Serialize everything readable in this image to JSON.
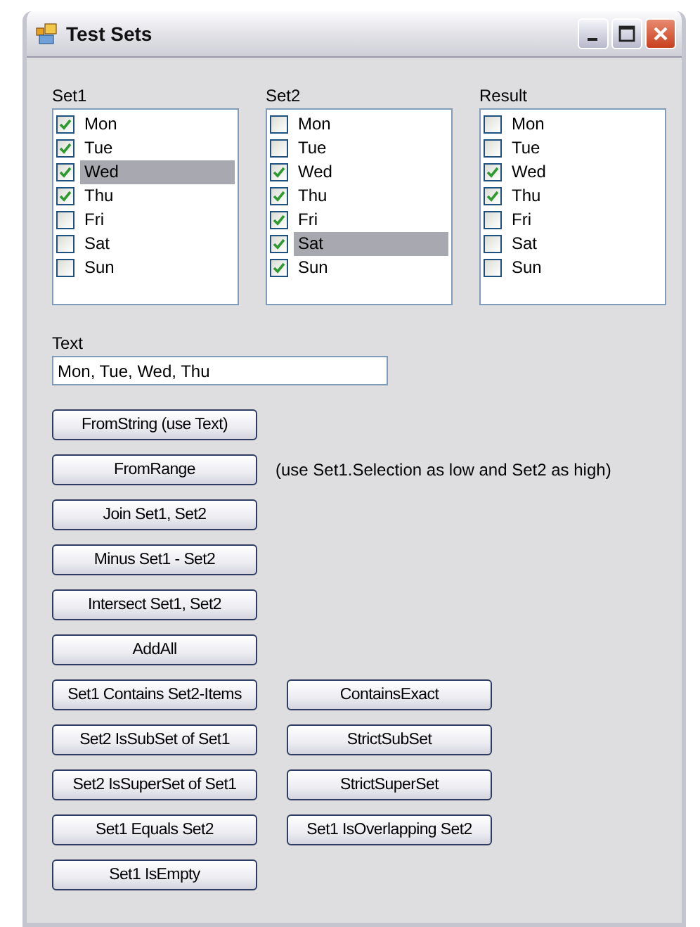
{
  "window": {
    "title": "Test Sets"
  },
  "lists": [
    {
      "label": "Set1",
      "items": [
        {
          "label": "Mon",
          "checked": true,
          "selected": false
        },
        {
          "label": "Tue",
          "checked": true,
          "selected": false
        },
        {
          "label": "Wed",
          "checked": true,
          "selected": true
        },
        {
          "label": "Thu",
          "checked": true,
          "selected": false
        },
        {
          "label": "Fri",
          "checked": false,
          "selected": false
        },
        {
          "label": "Sat",
          "checked": false,
          "selected": false
        },
        {
          "label": "Sun",
          "checked": false,
          "selected": false
        }
      ]
    },
    {
      "label": "Set2",
      "items": [
        {
          "label": "Mon",
          "checked": false,
          "selected": false
        },
        {
          "label": "Tue",
          "checked": false,
          "selected": false
        },
        {
          "label": "Wed",
          "checked": true,
          "selected": false
        },
        {
          "label": "Thu",
          "checked": true,
          "selected": false
        },
        {
          "label": "Fri",
          "checked": true,
          "selected": false
        },
        {
          "label": "Sat",
          "checked": true,
          "selected": true
        },
        {
          "label": "Sun",
          "checked": true,
          "selected": false
        }
      ]
    },
    {
      "label": "Result",
      "items": [
        {
          "label": "Mon",
          "checked": false,
          "selected": false
        },
        {
          "label": "Tue",
          "checked": false,
          "selected": false
        },
        {
          "label": "Wed",
          "checked": true,
          "selected": false
        },
        {
          "label": "Thu",
          "checked": true,
          "selected": false
        },
        {
          "label": "Fri",
          "checked": false,
          "selected": false
        },
        {
          "label": "Sat",
          "checked": false,
          "selected": false
        },
        {
          "label": "Sun",
          "checked": false,
          "selected": false
        }
      ]
    }
  ],
  "text_field": {
    "label": "Text",
    "value": "Mon, Tue, Wed, Thu"
  },
  "button_rows": [
    {
      "buttons": [
        "FromString (use Text)"
      ]
    },
    {
      "buttons": [
        "FromRange"
      ],
      "note": "(use Set1.Selection as low and Set2 as high)"
    },
    {
      "buttons": [
        "Join Set1, Set2"
      ]
    },
    {
      "buttons": [
        "Minus Set1 - Set2"
      ]
    },
    {
      "buttons": [
        "Intersect Set1, Set2"
      ]
    },
    {
      "buttons": [
        "AddAll"
      ]
    },
    {
      "buttons": [
        "Set1 Contains Set2-Items",
        "ContainsExact"
      ]
    },
    {
      "buttons": [
        "Set2 IsSubSet of Set1",
        "StrictSubSet"
      ]
    },
    {
      "buttons": [
        "Set2 IsSuperSet of Set1",
        "StrictSuperSet"
      ]
    },
    {
      "buttons": [
        "Set1 Equals Set2",
        "Set1 IsOverlapping Set2"
      ]
    },
    {
      "buttons": [
        "Set1 IsEmpty"
      ]
    }
  ]
}
